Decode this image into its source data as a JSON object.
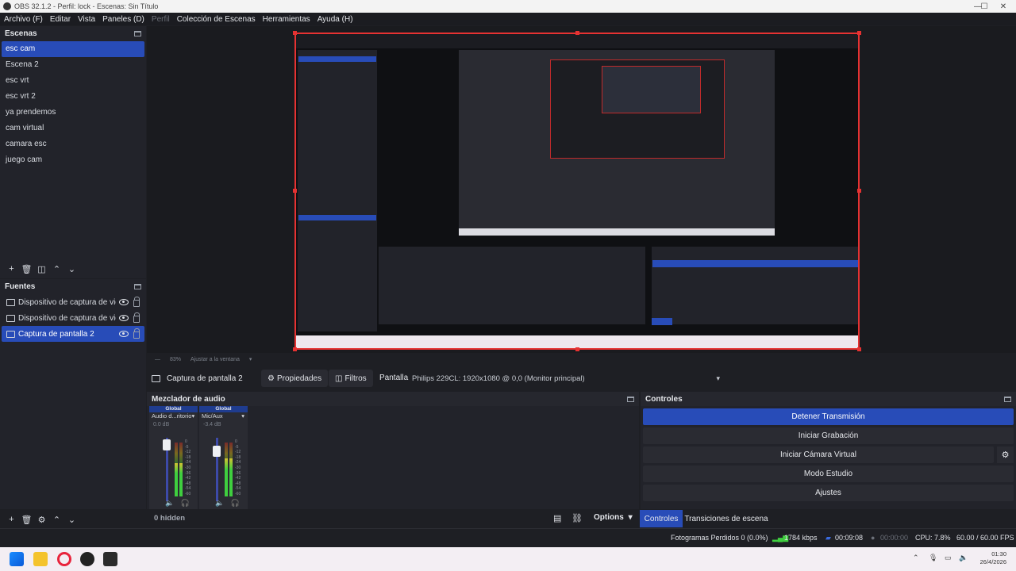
{
  "window": {
    "title": "OBS 32.1.2 - Perfil: lock - Escenas: Sin Título",
    "controls": {
      "minimize": "—",
      "maximize": "☐",
      "close": "✕"
    }
  },
  "menu": [
    "Archivo (F)",
    "Editar",
    "Vista",
    "Paneles (D)",
    "Perfil",
    "Colección de Escenas",
    "Herramientas",
    "Ayuda (H)"
  ],
  "scenes": {
    "title": "Escenas",
    "items": [
      "esc cam",
      "Escena 2",
      "esc vrt",
      "esc vrt 2",
      "ya prendemos",
      "cam virtual",
      "camara esc",
      "juego cam"
    ],
    "active_index": 0
  },
  "sources": {
    "title": "Fuentes",
    "items": [
      {
        "label": "Dispositivo de captura de video",
        "icon": "camera-icon"
      },
      {
        "label": "Dispositivo de captura de video",
        "icon": "camera-icon"
      },
      {
        "label": "Captura de pantalla 2",
        "icon": "monitor-icon"
      }
    ],
    "active_index": 2
  },
  "zoom": {
    "value": "83%",
    "fit": "Ajustar a la ventana"
  },
  "source_bar": {
    "selected": "Captura de pantalla 2",
    "properties": "Propiedades",
    "filters": "Filtros",
    "display_label": "Pantalla",
    "display_value": "Philips 229CL: 1920x1080 @ 0,0 (Monitor principal)"
  },
  "mixer": {
    "title": "Mezclador de audio",
    "channels": [
      {
        "scope": "Global",
        "name": "Audio d...ritorio",
        "db": "0.0 dB",
        "level": 0.62
      },
      {
        "scope": "Global",
        "name": "Mic/Aux",
        "db": "-3.4 dB",
        "level": 0.7
      }
    ],
    "ticks": [
      "0",
      "-5",
      "-12",
      "-18",
      "-24",
      "-30",
      "-36",
      "-42",
      "-48",
      "-54",
      "-60"
    ],
    "hidden_label": "0 hidden"
  },
  "controls": {
    "title": "Controles",
    "buttons": [
      "Detener Transmisión",
      "Iniciar Grabación",
      "Iniciar Cámara Virtual",
      "Modo Estudio",
      "Ajustes"
    ]
  },
  "dock": {
    "options": "Options",
    "tabs": [
      "Controles",
      "Transiciones de escena"
    ]
  },
  "status": {
    "dropped": "Fotogramas Perdidos 0 (0.0%)",
    "bitrate": "1784 kbps",
    "stream_time": "00:09:08",
    "rec_time": "00:00:00",
    "cpu": "CPU: 7.8%",
    "fps": "60.00 / 60.00 FPS"
  },
  "taskbar": {
    "time": "01:30",
    "date": "26/4/2026"
  },
  "colors": {
    "accent": "#284cb8",
    "selection_border": "#e63232",
    "panel": "#22232a",
    "background": "#1e1f24"
  }
}
